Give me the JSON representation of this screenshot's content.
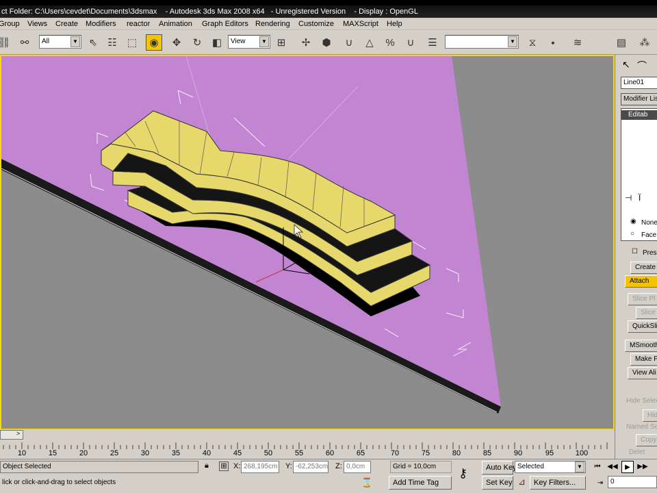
{
  "titlebar": {
    "text": "ct Folder: C:\\Users\\cevdet\\Documents\\3dsmax    - Autodesk 3ds Max 2008 x64   - Unregistered Version    - Display : OpenGL"
  },
  "menu": [
    "Group",
    "Views",
    "Create",
    "Modifiers",
    "reactor",
    "Animation",
    "Graph Editors",
    "Rendering",
    "Customize",
    "MAXScript",
    "Help"
  ],
  "toolbar": {
    "selection_filter": "All",
    "reference_coord": "View",
    "named_selection": ""
  },
  "command_panel": {
    "object_name": "Line01",
    "modifier_list": "Modifier Lis",
    "stack_item": "Editab",
    "radio_none": "None",
    "radio_face": "Face",
    "checkbox_preserve": "Pres",
    "buttons": {
      "create": "Create",
      "attach": "Attach",
      "slice_plane": "Slice Pl",
      "slice": "Slice",
      "quickslice": "QuickSli",
      "msmooth": "MSmooth",
      "make_planar": "Make Pl",
      "view_align": "View Ali",
      "hide_selected": "Hide Selec",
      "hide": "Hid",
      "named_selections": "Named Se",
      "copy": "Copy",
      "delete": "Delet"
    }
  },
  "timeline": {
    "slider_text": "",
    "ticks": [
      "10",
      "15",
      "20",
      "25",
      "30",
      "35",
      "40",
      "45",
      "50",
      "55",
      "60",
      "65",
      "70",
      "75",
      "80",
      "85",
      "90",
      "95",
      "100"
    ]
  },
  "status": {
    "selection": "Object Selected",
    "prompt": "lick or click-and-drag to select objects",
    "x_label": "X:",
    "x_value": "268,195cm",
    "y_label": "Y:",
    "y_value": "-62,253cm",
    "z_label": "Z:",
    "z_value": "0,0cm",
    "grid": "Grid = 10,0cm",
    "add_time_tag": "Add Time Tag",
    "auto_key": "Auto Key",
    "set_key": "Set Key",
    "key_mode": "Selected",
    "key_filters": "Key Filters...",
    "frame": "0"
  },
  "colors": {
    "viewport_border": "#ffd800",
    "ground_plane": "#c185d1",
    "object_faces": "#e6d86a",
    "active_button": "#f5c400"
  }
}
